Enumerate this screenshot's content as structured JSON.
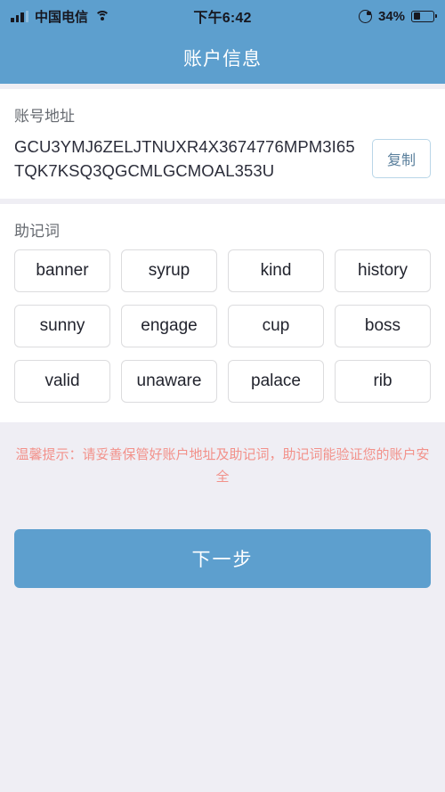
{
  "status_bar": {
    "carrier": "中国电信",
    "time": "下午6:42",
    "battery_percent": "34%",
    "icons": {
      "signal": "signal-bars-icon",
      "wifi": "wifi-icon",
      "rotation_lock": "rotation-lock-icon",
      "battery": "battery-icon"
    }
  },
  "header": {
    "title": "账户信息"
  },
  "address_section": {
    "label": "账号地址",
    "address": "GCU3YMJ6ZELJTNUXR4X3674776MPM3I65TQK7KSQ3QGCMLGCMOAL353U",
    "copy_label": "复制"
  },
  "mnemonic_section": {
    "label": "助记词",
    "words": [
      "banner",
      "syrup",
      "kind",
      "history",
      "sunny",
      "engage",
      "cup",
      "boss",
      "valid",
      "unaware",
      "palace",
      "rib"
    ]
  },
  "warning": {
    "text": "温馨提示：请妥善保管好账户地址及助记词，助记词能验证您的账户安全"
  },
  "footer": {
    "next_label": "下一步"
  },
  "colors": {
    "accent_blue": "#5d9fce",
    "page_bg": "#efeef4",
    "card_bg": "#ffffff",
    "warning_text": "#f2918a",
    "chip_border": "#dcdcde",
    "label_text": "#666a70"
  }
}
